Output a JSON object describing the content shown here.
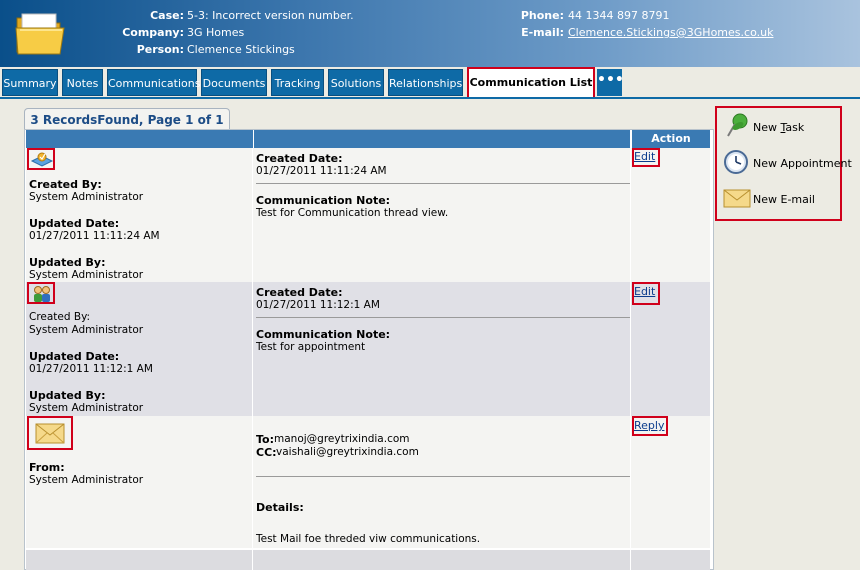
{
  "header": {
    "case_label": "Case:",
    "case_value": "5-3: Incorrect version number.",
    "company_label": "Company:",
    "company_value": "3G Homes",
    "person_label": "Person:",
    "person_value": "Clemence Stickings",
    "phone_label": "Phone:",
    "phone_value": "44 1344 897 8791",
    "email_label": "E-mail:",
    "email_value": "Clemence.Stickings@3GHomes.co.uk"
  },
  "tabs": [
    {
      "label": "Summary"
    },
    {
      "label": "Notes"
    },
    {
      "label": "Communications"
    },
    {
      "label": "Documents"
    },
    {
      "label": "Tracking"
    },
    {
      "label": "Solutions"
    },
    {
      "label": "Relationships"
    },
    {
      "label": "Communication List"
    }
  ],
  "tab_more": "•••",
  "records": {
    "summary": "3 RecordsFound, Page 1 of 1",
    "action_header": "Action"
  },
  "rows": [
    {
      "icon": "task-icon",
      "created_by_label": "Created By:",
      "created_by": "System Administrator",
      "updated_date_label": "Updated Date:",
      "updated_date": "01/27/2011 11:11:24 AM",
      "updated_by_label": "Updated By:",
      "updated_by": "System Administrator",
      "created_date_label": "Created Date:",
      "created_date": "01/27/2011 11:11:24 AM",
      "note_label": "Communication Note:",
      "note": "Test for Communication thread view.",
      "action": "Edit"
    },
    {
      "icon": "appointment-people-icon",
      "created_by_label": "Created By:",
      "created_by": "System Administrator",
      "updated_date_label": "Updated Date:",
      "updated_date": "01/27/2011 11:12:1 AM",
      "updated_by_label": "Updated By:",
      "updated_by": "System Administrator",
      "created_date_label": "Created Date:",
      "created_date": "01/27/2011 11:12:1 AM",
      "note_label": "Communication Note:",
      "note": "Test for appointment",
      "action": "Edit"
    },
    {
      "icon": "email-envelope-icon",
      "from_label": "From:",
      "from": "System Administrator",
      "to_label": "To:",
      "to": "manoj@greytrixindia.com",
      "cc_label": "CC:",
      "cc": "vaishali@greytrixindia.com",
      "details_label": "Details:",
      "details": "Test Mail foe threded viw communications.",
      "action": "Reply"
    }
  ],
  "right_panel": {
    "task_prefix": "New ",
    "task_accel": "T",
    "task_rest": "ask",
    "appointment": "New Appointment",
    "email": "New E-mail"
  },
  "colors": {
    "tab_blue": "#0e6aa6",
    "highlight_red": "#d0001b",
    "column_header": "#3a7ab3",
    "link_blue": "#0b3c8c"
  }
}
